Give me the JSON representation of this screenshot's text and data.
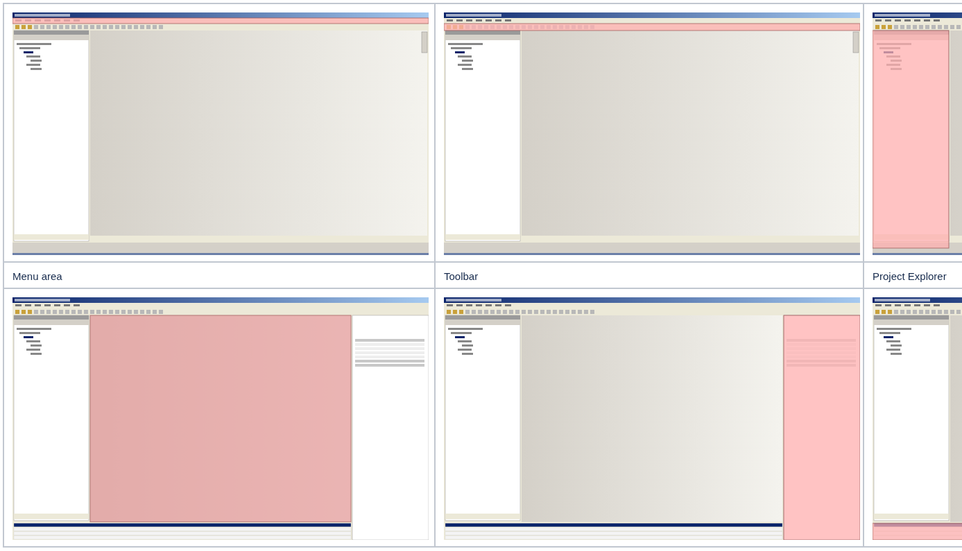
{
  "rows": [
    {
      "kind": "screenshots",
      "cells": [
        {
          "kind": "basic",
          "regions": [
            {
              "kind": "menu",
              "highlighted": true
            }
          ]
        },
        {
          "kind": "basic",
          "regions": [
            {
              "kind": "toolbar",
              "highlighted": true
            }
          ]
        },
        {
          "kind": "basic",
          "regions": [
            {
              "kind": "explorer",
              "highlighted": true
            }
          ]
        }
      ]
    },
    {
      "kind": "captions",
      "cells": [
        "Menu area",
        "Toolbar",
        "Project Explorer"
      ]
    },
    {
      "kind": "screenshots",
      "cells": [
        {
          "kind": "full",
          "regions": [
            {
              "kind": "editor",
              "highlighted": true
            }
          ]
        },
        {
          "kind": "full",
          "regions": [
            {
              "kind": "properties",
              "highlighted": true
            }
          ]
        },
        {
          "kind": "full",
          "regions": [
            {
              "kind": "messages",
              "highlighted": true
            }
          ]
        }
      ]
    }
  ]
}
